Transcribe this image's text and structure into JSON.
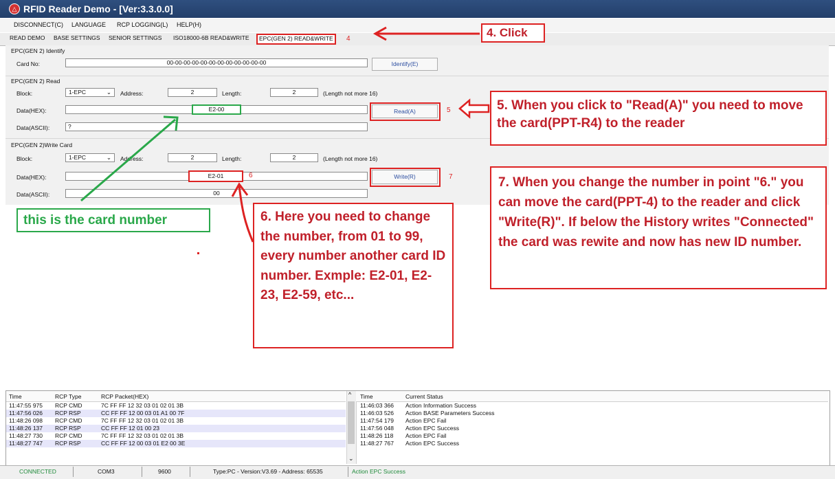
{
  "window": {
    "title": "RFID Reader Demo - [Ver:3.3.0.0]"
  },
  "menu": [
    "DISCONNECT(C)",
    "LANGUAGE",
    "RCP LOGGING(L)",
    "HELP(H)"
  ],
  "tabs": [
    "READ DEMO",
    "BASE SETTINGS",
    "SENIOR SETTINGS",
    "ISO18000-6B READ&WRITE",
    "EPC(GEN 2) READ&WRITE"
  ],
  "identify": {
    "section": "EPC(GEN 2) Identify",
    "card_label": "Card No:",
    "card_value": "00-00-00-00-00-00-00-00-00-00-00-00",
    "button": "Identify(E)"
  },
  "read": {
    "section": "EPC(GEN 2) Read",
    "block_label": "Block:",
    "block_value": "1-EPC",
    "address_label": "Address:",
    "address_value": "2",
    "length_label": "Length:",
    "length_value": "2",
    "length_note": "(Length not more 16)",
    "hex_label": "Data(HEX):",
    "hex_value": "E2-00",
    "ascii_label": "Data(ASCII):",
    "ascii_value": "?",
    "button": "Read(A)"
  },
  "write": {
    "section": "EPC(GEN 2)Write Card",
    "block_label": "Block:",
    "block_value": "1-EPC",
    "address_label": "Address:",
    "address_value": "2",
    "length_label": "Length:",
    "length_value": "2",
    "length_note": "(Length not more 16)",
    "hex_label": "Data(HEX):",
    "hex_value": "E2-01",
    "ascii_label": "Data(ASCII):",
    "ascii_value": "00",
    "button": "Write(R)"
  },
  "annotations": {
    "n4": "4",
    "n5": "5",
    "n6": "6",
    "n7": "7",
    "click": "4. Click",
    "step5": "5. When you click to \"Read(A)\" you need to move the card(PPT-R4) to the reader",
    "step6": "6. Here you need to change the number, from 01 to 99, every number another card ID number. Exmple: E2-01, E2-23, E2-59, etc...",
    "step7": "7. When you change the number in point \"6.\" you can move the card(PPT-4) to the reader and click \"Write(R)\". If below the History writes \"Connected\" the card was rewite and now has new ID number.",
    "card_number": "this is the card number"
  },
  "rcp_log": {
    "headers": [
      "Time",
      "RCP Type",
      "RCP Packet(HEX)"
    ],
    "rows": [
      [
        "11:47:55 975",
        "RCP CMD",
        "7C FF FF 12 32 03 01 02 01 3B"
      ],
      [
        "11:47:56 026",
        "RCP RSP",
        "CC FF FF 12 00 03 01 A1 00 7F"
      ],
      [
        "11:48:26 098",
        "RCP CMD",
        "7C FF FF 12 32 03 01 02 01 3B"
      ],
      [
        "11:48:26 137",
        "RCP RSP",
        "CC FF FF 12 01 00 23"
      ],
      [
        "11:48:27 730",
        "RCP CMD",
        "7C FF FF 12 32 03 01 02 01 3B"
      ],
      [
        "11:48:27 747",
        "RCP RSP",
        "CC FF FF 12 00 03 01 E2 00 3E"
      ]
    ]
  },
  "status_log": {
    "headers": [
      "Time",
      "Current Status"
    ],
    "rows": [
      [
        "11:46:03 366",
        "Action Information Success"
      ],
      [
        "11:46:03 526",
        "Action BASE Parameters Success"
      ],
      [
        "11:47:54 179",
        "Action EPC Fail"
      ],
      [
        "11:47:56 048",
        "Action EPC Success"
      ],
      [
        "11:48:26 118",
        "Action EPC Fail"
      ],
      [
        "11:48:27 767",
        "Action EPC Success"
      ]
    ]
  },
  "statusbar": {
    "connection": "CONNECTED",
    "port": "COM3",
    "baud": "9600",
    "info": "Type:PC - Version:V3.69 - Address: 65535",
    "last": "Action EPC Success"
  },
  "colors": {
    "accent_red": "#d22222",
    "callout_green": "#2aa84a",
    "connected_green": "#1f8a3a",
    "titlebar": "#2f4f7f"
  }
}
